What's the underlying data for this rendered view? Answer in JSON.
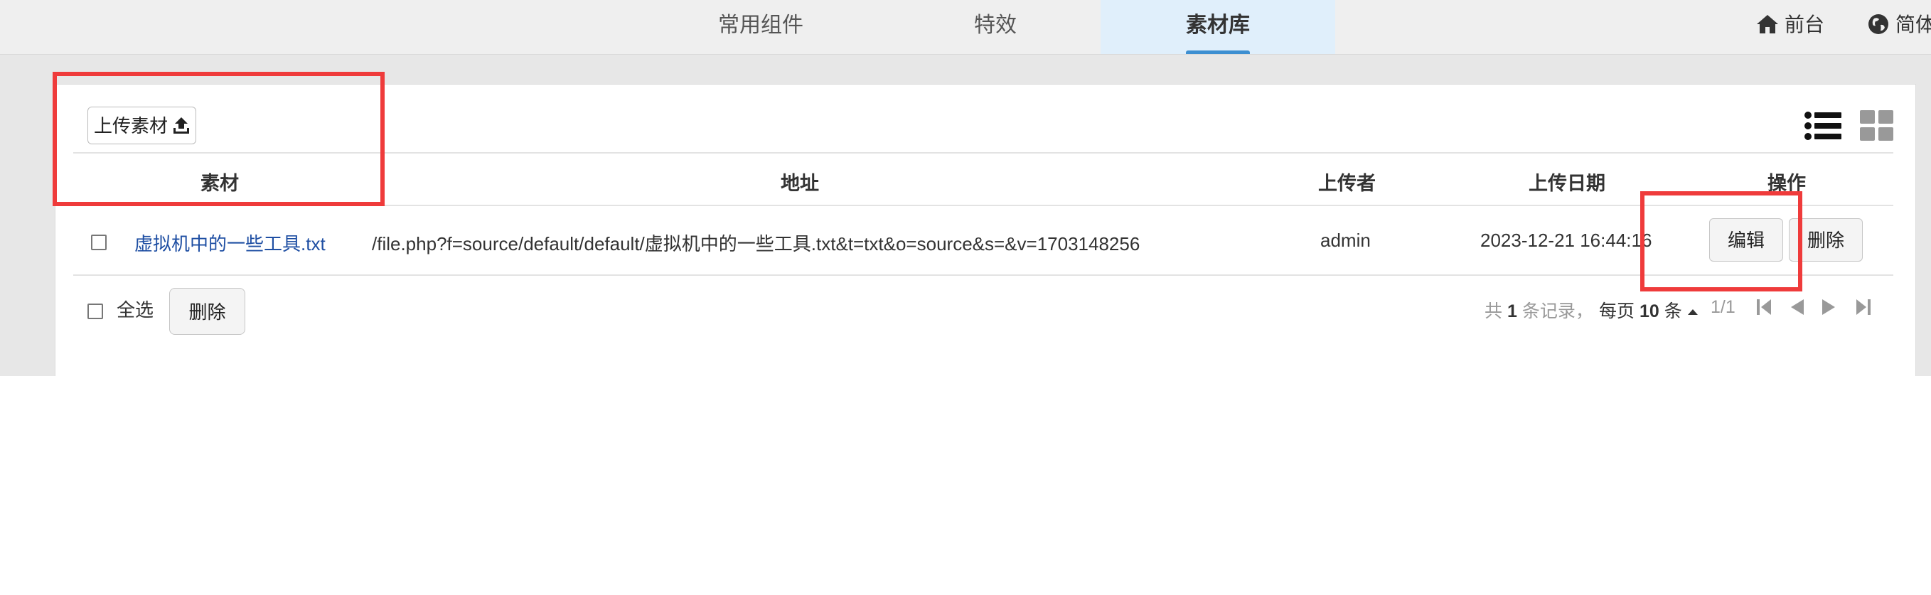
{
  "nav": {
    "tabs": [
      {
        "label": "常用组件"
      },
      {
        "label": "特效"
      },
      {
        "label": "素材库",
        "active": true
      }
    ],
    "home": {
      "label": "前台",
      "icon": "home-icon"
    },
    "lang": {
      "label": "简体",
      "icon": "globe-icon"
    }
  },
  "toolbar": {
    "upload_label": "上传素材",
    "upload_icon": "upload-icon",
    "list_view_icon": "list-view-icon",
    "grid_view_icon": "grid-view-icon"
  },
  "table": {
    "columns": [
      "素材",
      "地址",
      "上传者",
      "上传日期",
      "操作"
    ],
    "rows": [
      {
        "name": "虚拟机中的一些工具.txt",
        "address": "/file.php?f=source/default/default/虚拟机中的一些工具.txt&t=txt&o=source&s=&v=1703148256",
        "uploader": "admin",
        "date": "2023-12-21 16:44:16",
        "edit_label": "编辑",
        "delete_label": "删除"
      }
    ]
  },
  "footer": {
    "select_all_label": "全选",
    "delete_label": "删除"
  },
  "pagination": {
    "total_prefix": "共",
    "total_count": "1",
    "total_suffix": "条记录，",
    "per_page_prefix": "每页",
    "per_page": "10",
    "per_page_suffix": "条",
    "page": "1/1"
  },
  "colors": {
    "accent": "#3d8fd1",
    "annotation": "#ef3b3b",
    "link": "#1f4fa3"
  }
}
